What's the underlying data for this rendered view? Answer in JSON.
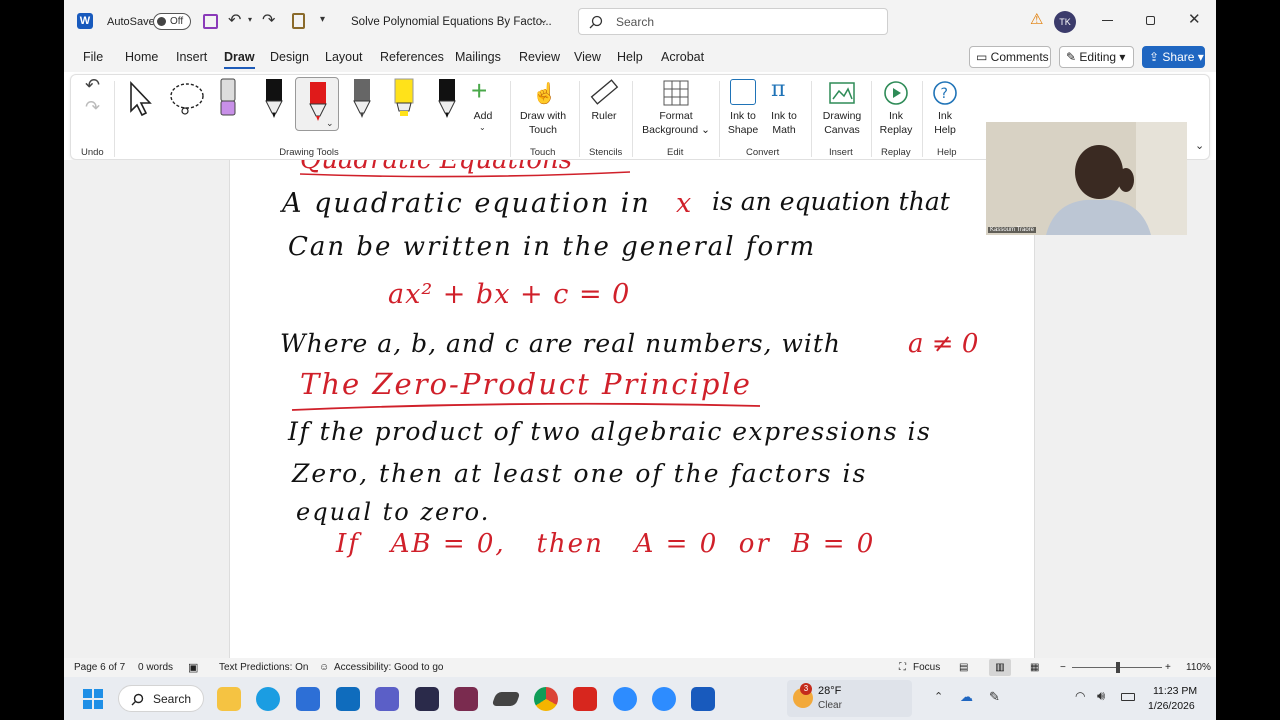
{
  "titlebar": {
    "autosave_label": "AutoSave",
    "autosave_state": "Off",
    "doc_title": "Solve Polynomial Equations By Facto...",
    "search_placeholder": "Search",
    "user_initials": "TK"
  },
  "menu": {
    "items": [
      "File",
      "Home",
      "Insert",
      "Draw",
      "Design",
      "Layout",
      "References",
      "Mailings",
      "Review",
      "View",
      "Help",
      "Acrobat"
    ],
    "active": "Draw",
    "comments_label": "Comments",
    "editing_label": "Editing",
    "share_label": "Share"
  },
  "ribbon": {
    "add_label": "Add",
    "draw_with_touch": [
      "Draw with",
      "Touch"
    ],
    "ruler_label": "Ruler",
    "format_background": [
      "Format",
      "Background"
    ],
    "ink_to_shape": [
      "Ink to",
      "Shape"
    ],
    "ink_to_math": [
      "Ink to",
      "Math"
    ],
    "drawing_canvas": [
      "Drawing",
      "Canvas"
    ],
    "ink_replay": [
      "Ink",
      "Replay"
    ],
    "ink_help": [
      "Ink",
      "Help"
    ],
    "groups": {
      "undo": "Undo",
      "drawing_tools": "Drawing Tools",
      "touch": "Touch",
      "stencils": "Stencils",
      "edit": "Edit",
      "convert": "Convert",
      "insert": "Insert",
      "replay": "Replay",
      "help": "Help"
    }
  },
  "webcam": {
    "name": "Kassoum Traore"
  },
  "document": {
    "line_partial_title": "Quadratic Equations",
    "line1": "A quadratic equation in",
    "line1_var": "x",
    "line1_rest": "is an equation that",
    "line2": "Can be written in the general form",
    "formula": "ax² + bx + c = 0",
    "line3": "Where a, b, and c are real numbers, with",
    "line3_cond": "a ≠ 0",
    "heading": "The Zero-Product Principle",
    "line4": "If the product of two algebraic expressions is",
    "line5": "Zero, then at least one of the factors is",
    "line6": "equal to zero.",
    "line7": "If   AB = 0,   then   A = 0  or  B = 0"
  },
  "statusbar": {
    "page": "Page 6 of 7",
    "words": "0 words",
    "text_predictions": "Text Predictions: On",
    "accessibility": "Accessibility: Good to go",
    "focus": "Focus",
    "zoom": "110%"
  },
  "taskbar": {
    "search_label": "Search",
    "weather_temp": "28°F",
    "weather_desc": "Clear",
    "weather_badge": "3",
    "time": "11:23 PM",
    "date": "1/26/2026"
  },
  "colors": {
    "accent": "#1f66c1",
    "ink_red": "#d0202a",
    "ink_black": "#111111",
    "word_blue": "#185abd"
  }
}
